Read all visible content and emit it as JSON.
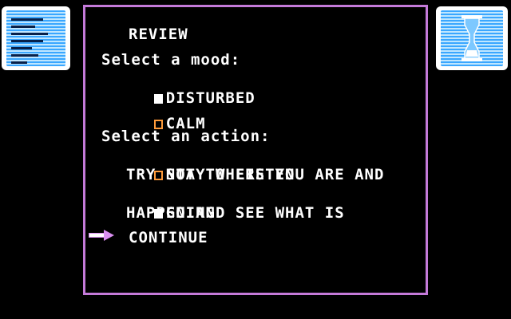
{
  "title": "REVIEW",
  "mood_prompt": "Select a mood:",
  "moods": [
    {
      "label": "DISTURBED",
      "checked": true
    },
    {
      "label": "CALM",
      "checked": false
    }
  ],
  "action_prompt": "Select an action:",
  "actions": [
    {
      "line1": "STAY WHERE YOU ARE AND",
      "line2": "TRY NOT TO LISTEN",
      "checked": false
    },
    {
      "line1": "GO AND SEE WHAT IS",
      "line2": "HAPPENING",
      "checked": true
    }
  ],
  "continue_label": "CONTINUE",
  "colors": {
    "panel_border": "#c47ad9",
    "checkbox_unchecked": "#ff9b3a",
    "icon_blue": "#3aa7ff",
    "arrow": "#d98ef0"
  },
  "icons": {
    "left": "list-icon",
    "right": "hourglass-icon",
    "pointer": "arrow-right-icon"
  }
}
